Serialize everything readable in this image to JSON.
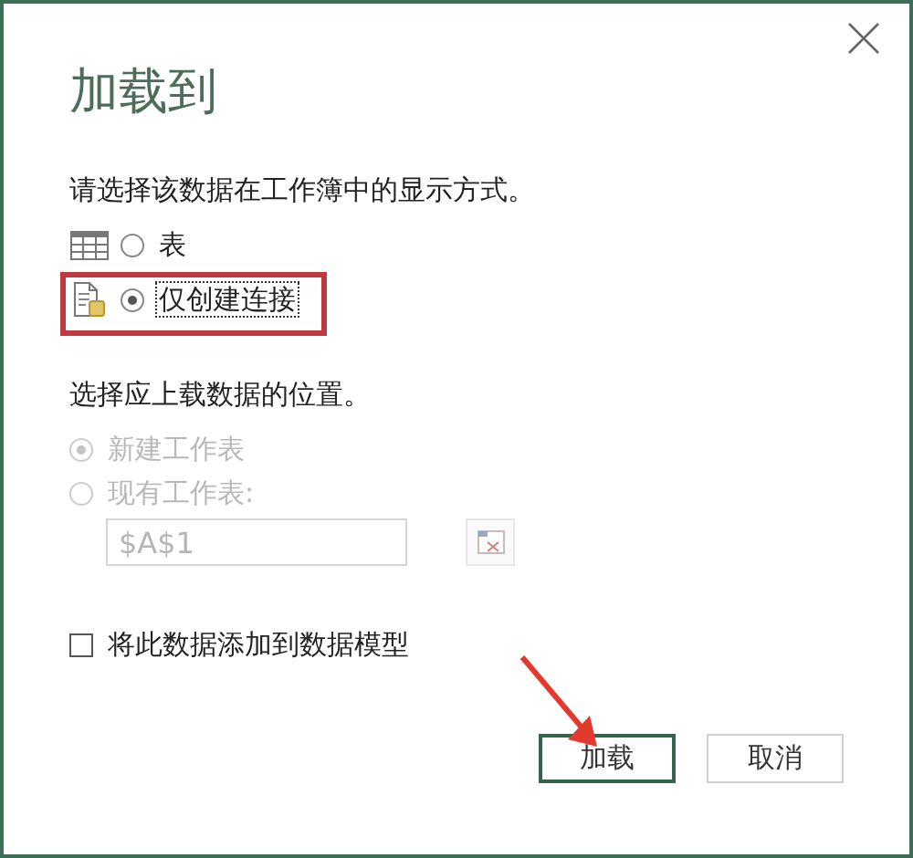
{
  "dialog": {
    "title": "加载到"
  },
  "display_prompt": "请选择该数据在工作簿中的显示方式。",
  "display_options": [
    {
      "kind": "table",
      "label": "表",
      "selected": false,
      "focused": false
    },
    {
      "kind": "connection",
      "label": "仅创建连接",
      "selected": true,
      "focused": true
    }
  ],
  "location_prompt": "选择应上载数据的位置。",
  "location_options": [
    {
      "label": "新建工作表",
      "selected": true,
      "disabled": true
    },
    {
      "label": "现有工作表:",
      "selected": false,
      "disabled": true
    }
  ],
  "cell_reference": {
    "value": "$A$1",
    "disabled": true
  },
  "data_model_checkbox": {
    "label": "将此数据添加到数据模型",
    "checked": false
  },
  "buttons": [
    {
      "label": "加载",
      "kind": "primary"
    },
    {
      "label": "取消",
      "kind": "secondary"
    }
  ]
}
